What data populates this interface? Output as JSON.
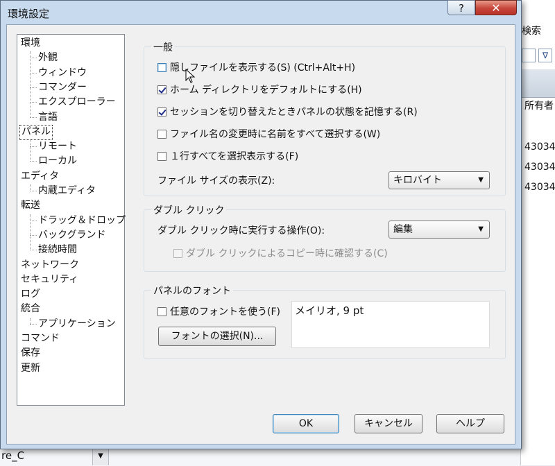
{
  "window": {
    "title": "環境設定",
    "help_glyph": "?",
    "close_glyph": "✕"
  },
  "background": {
    "search_label": "検索",
    "column_header": "所有者",
    "numbers": [
      "43034",
      "43034",
      "43034"
    ],
    "bottom_text": "re_C",
    "scroll_glyph": "▼"
  },
  "tree": [
    {
      "label": "環境",
      "level": 0
    },
    {
      "label": "外観",
      "level": 1
    },
    {
      "label": "ウィンドウ",
      "level": 1
    },
    {
      "label": "コマンダー",
      "level": 1
    },
    {
      "label": "エクスプローラー",
      "level": 1
    },
    {
      "label": "言語",
      "level": 1
    },
    {
      "label": "パネル",
      "level": 0,
      "selected": true
    },
    {
      "label": "リモート",
      "level": 1
    },
    {
      "label": "ローカル",
      "level": 1
    },
    {
      "label": "エディタ",
      "level": 0
    },
    {
      "label": "内蔵エディタ",
      "level": 1
    },
    {
      "label": "転送",
      "level": 0
    },
    {
      "label": "ドラッグ＆ドロップ",
      "level": 1
    },
    {
      "label": "バックグランド",
      "level": 1
    },
    {
      "label": "接続時間",
      "level": 1
    },
    {
      "label": "ネットワーク",
      "level": 0
    },
    {
      "label": "セキュリティ",
      "level": 0
    },
    {
      "label": "ログ",
      "level": 0
    },
    {
      "label": "統合",
      "level": 0
    },
    {
      "label": "アプリケーション",
      "level": 1
    },
    {
      "label": "コマンド",
      "level": 0
    },
    {
      "label": "保存",
      "level": 0
    },
    {
      "label": "更新",
      "level": 0
    }
  ],
  "general": {
    "label": "一般",
    "show_hidden": {
      "label": "隠しファイルを表示する(S) (Ctrl+Alt+H)",
      "checked": false
    },
    "home_default": {
      "label": "ホーム ディレクトリをデフォルトにする(H)",
      "checked": true
    },
    "remember_state": {
      "label": "セッションを切り替えたときパネルの状態を記憶する(R)",
      "checked": true
    },
    "select_full_name": {
      "label": "ファイル名の変更時に名前をすべて選択する(W)",
      "checked": false
    },
    "full_row_select": {
      "label": "１行すべてを選択表示する(F)",
      "checked": false
    },
    "file_size_label": "ファイル サイズの表示(Z):",
    "file_size_value": "キロバイト"
  },
  "double_click": {
    "label": "ダブル クリック",
    "action_label": "ダブル クリック時に実行する操作(O):",
    "action_value": "編集",
    "confirm_copy": {
      "label": "ダブル クリックによるコピー時に確認する(C)",
      "checked": false,
      "disabled": true
    }
  },
  "panel_font": {
    "label": "パネルのフォント",
    "use_custom": {
      "label": "任意のフォントを使う(F)",
      "checked": false
    },
    "select_button": "フォントの選択(N)...",
    "preview": "メイリオ, 9 pt"
  },
  "buttons": {
    "ok": "OK",
    "cancel": "キャンセル",
    "help": "ヘルプ"
  },
  "colors": {
    "titlebar": "#c8daee",
    "close": "#c6463a",
    "selected_border": "#333333"
  }
}
